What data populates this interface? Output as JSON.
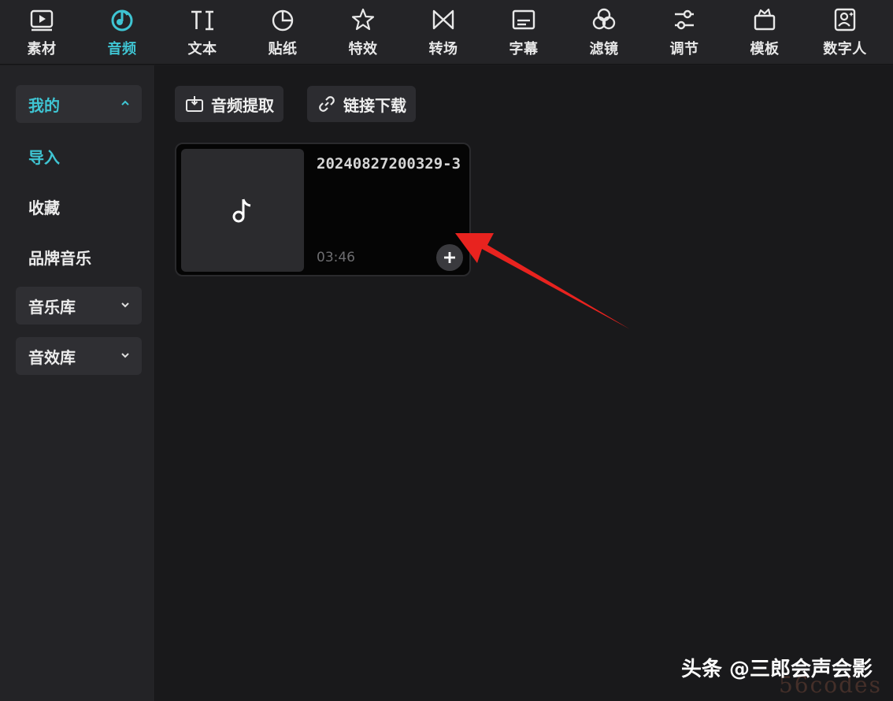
{
  "toolbar": {
    "items": [
      {
        "label": "素材",
        "icon": "media-icon"
      },
      {
        "label": "音频",
        "icon": "audio-icon",
        "active": true
      },
      {
        "label": "文本",
        "icon": "text-icon"
      },
      {
        "label": "贴纸",
        "icon": "sticker-icon"
      },
      {
        "label": "特效",
        "icon": "effects-icon"
      },
      {
        "label": "转场",
        "icon": "transition-icon"
      },
      {
        "label": "字幕",
        "icon": "subtitle-icon"
      },
      {
        "label": "滤镜",
        "icon": "filter-icon"
      },
      {
        "label": "调节",
        "icon": "adjust-icon"
      },
      {
        "label": "模板",
        "icon": "template-icon"
      },
      {
        "label": "数字人",
        "icon": "digital-human-icon"
      }
    ],
    "accent_color": "#3fc5d3"
  },
  "sidebar": {
    "items": [
      {
        "label": "我的"
      },
      {
        "label": "导入"
      },
      {
        "label": "收藏"
      },
      {
        "label": "品牌音乐"
      },
      {
        "label": "音乐库"
      },
      {
        "label": "音效库"
      }
    ]
  },
  "main": {
    "extract_audio_label": "音频提取",
    "link_download_label": "链接下载",
    "card": {
      "title": "20240827200329-3",
      "duration": "03:46"
    }
  },
  "watermark": {
    "text": "头条 @三郎会声会影",
    "faint_text": "56codes"
  },
  "annotation_arrow_color": "#e8231f"
}
